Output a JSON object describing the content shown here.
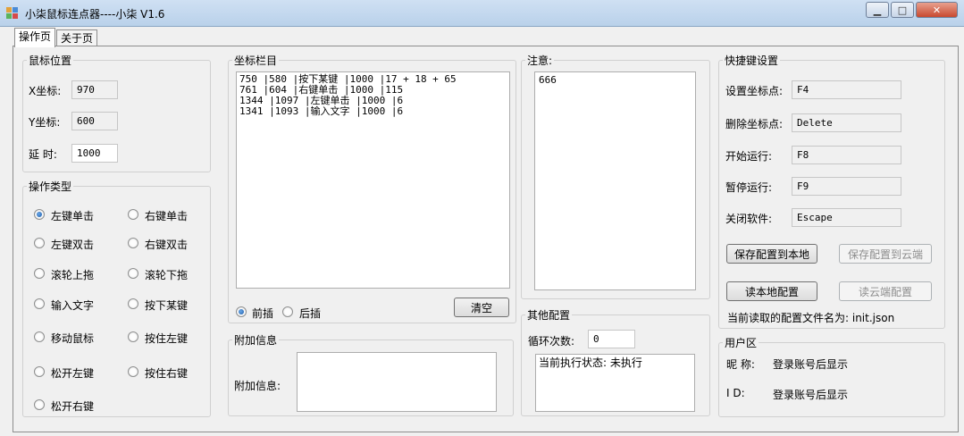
{
  "window": {
    "title": "小柒鼠标连点器----小柒 V1.6"
  },
  "tabs": [
    "操作页",
    "关于页"
  ],
  "mouse_position": {
    "group_label": "鼠标位置",
    "x_label": "X坐标:",
    "x_value": "970",
    "y_label": "Y坐标:",
    "y_value": "600",
    "delay_label": "延 时:",
    "delay_value": "1000"
  },
  "operation_type": {
    "group_label": "操作类型",
    "options": [
      "左键单击",
      "右键单击",
      "左键双击",
      "右键双击",
      "滚轮上拖",
      "滚轮下拖",
      "输入文字",
      "按下某键",
      "移动鼠标",
      "按住左键",
      "松开左键",
      "按住右键",
      "松开右键"
    ],
    "selected": "左键单击"
  },
  "coordinates": {
    "group_label": "坐标栏目",
    "rows": [
      "750 |580 |按下某键 |1000 |17 + 18 + 65",
      "761 |604 |右键单击 |1000 |115",
      "1344 |1097 |左键单击 |1000 |6",
      "1341 |1093 |输入文字 |1000 |6"
    ],
    "insert_before": "前插",
    "insert_after": "后插",
    "insert_selected": "前插",
    "clear_button": "清空"
  },
  "extra_info": {
    "group_label": "附加信息",
    "field_label": "附加信息:",
    "value": ""
  },
  "notes": {
    "group_label": "注意:",
    "text": "666"
  },
  "other_config": {
    "group_label": "其他配置",
    "loop_label": "循环次数:",
    "loop_value": "0",
    "status_text": "当前执行状态: 未执行"
  },
  "hotkeys": {
    "group_label": "快捷键设置",
    "items": [
      {
        "label": "设置坐标点:",
        "value": "F4"
      },
      {
        "label": "删除坐标点:",
        "value": "Delete"
      },
      {
        "label": "开始运行:",
        "value": "F8"
      },
      {
        "label": "暂停运行:",
        "value": "F9"
      },
      {
        "label": "关闭软件:",
        "value": "Escape"
      }
    ],
    "save_local": "保存配置到本地",
    "save_cloud": "保存配置到云端",
    "read_local": "读本地配置",
    "read_cloud": "读云端配置",
    "config_file_text": "当前读取的配置文件名为: init.json"
  },
  "user": {
    "group_label": "用户区",
    "nick_label": "昵  称:",
    "nick_value": "登录账号后显示",
    "id_label": "I D:",
    "id_value": "登录账号后显示"
  },
  "colors": {
    "titlebar": "#b9d1ea",
    "close": "#c8492f",
    "radio_on": "#1c5aa6"
  }
}
